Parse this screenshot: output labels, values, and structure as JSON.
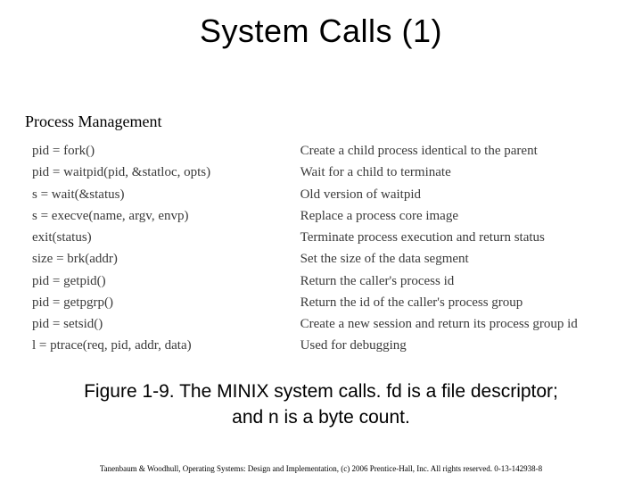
{
  "title": "System Calls (1)",
  "subtitle": "Process Management",
  "rows": [
    {
      "call": "pid = fork()",
      "desc": "Create a child process identical to the parent"
    },
    {
      "call": "pid = waitpid(pid, &statloc, opts)",
      "desc": "Wait for a child to terminate"
    },
    {
      "call": "s = wait(&status)",
      "desc": "Old version of waitpid"
    },
    {
      "call": "s = execve(name, argv, envp)",
      "desc": "Replace a process core image"
    },
    {
      "call": "exit(status)",
      "desc": "Terminate process execution and return status"
    },
    {
      "call": "size = brk(addr)",
      "desc": "Set the size of the data segment"
    },
    {
      "call": "pid = getpid()",
      "desc": "Return the caller's process id"
    },
    {
      "call": "pid = getpgrp()",
      "desc": "Return the id of the caller's process group"
    },
    {
      "call": "pid = setsid()",
      "desc": "Create a new session and return its process group id"
    },
    {
      "call": "l = ptrace(req, pid, addr, data)",
      "desc": "Used for debugging"
    }
  ],
  "caption_line1": "Figure 1-9. The MINIX system calls. fd is a file descriptor;",
  "caption_line2": "and n is a byte count.",
  "footer": "Tanenbaum & Woodhull, Operating Systems: Design and Implementation, (c) 2006 Prentice-Hall, Inc. All rights reserved. 0-13-142938-8"
}
